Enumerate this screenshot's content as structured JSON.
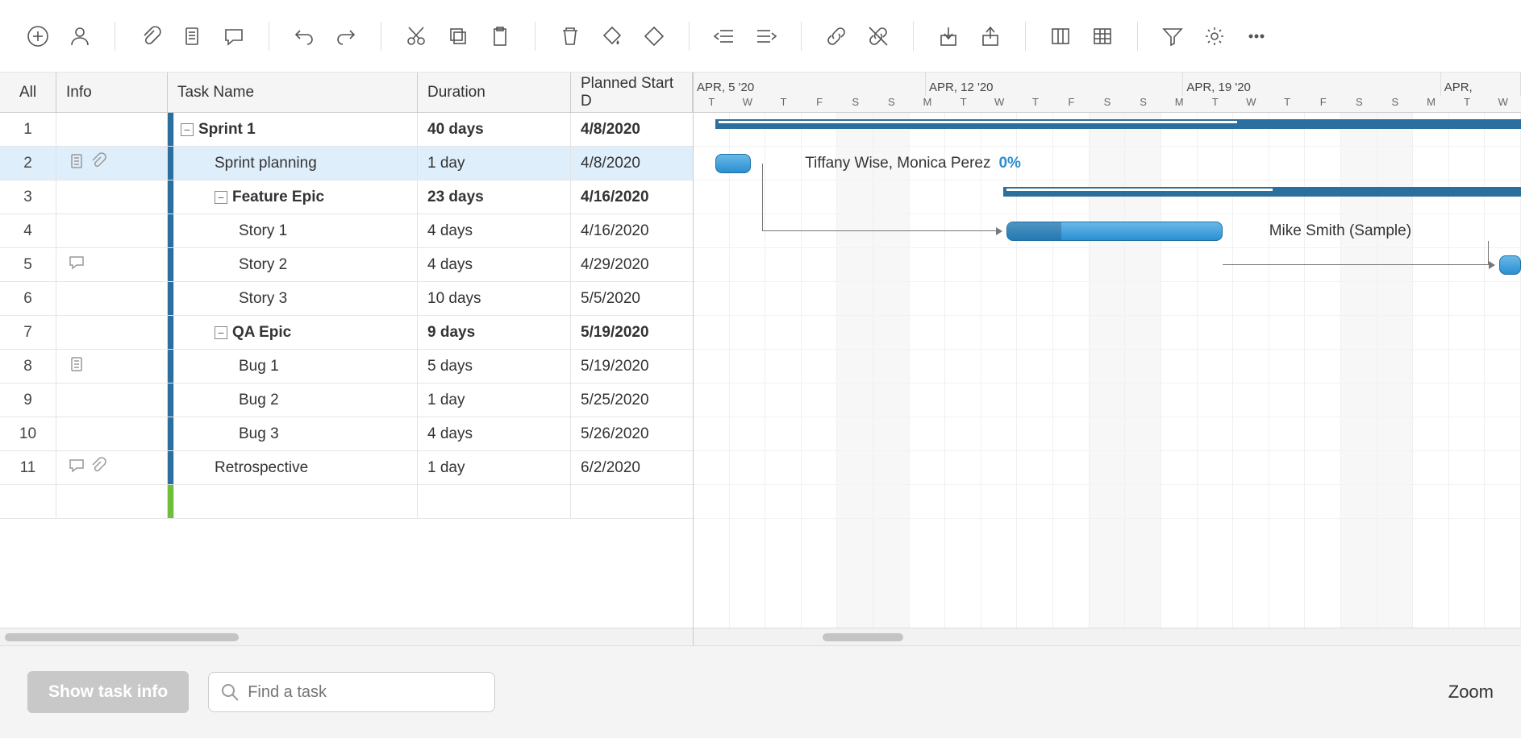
{
  "toolbar_icons": [
    "add",
    "person",
    "sep",
    "attach",
    "doc",
    "comment",
    "sep",
    "undo",
    "redo",
    "sep",
    "cut",
    "copy",
    "paste",
    "sep",
    "delete",
    "fill",
    "diamond",
    "sep",
    "outdent",
    "indent",
    "sep",
    "link",
    "unlink",
    "sep",
    "import",
    "export",
    "sep",
    "columns",
    "grid",
    "sep",
    "filter",
    "settings",
    "more"
  ],
  "grid": {
    "headers": {
      "all": "All",
      "info": "Info",
      "task": "Task Name",
      "duration": "Duration",
      "start": "Planned Start D"
    },
    "rows": [
      {
        "num": "1",
        "icons": [],
        "indent": 0,
        "collapsible": true,
        "name": "Sprint 1",
        "duration": "40 days",
        "start": "4/8/2020",
        "bold": true,
        "selected": false
      },
      {
        "num": "2",
        "icons": [
          "doc",
          "clip"
        ],
        "indent": 1,
        "collapsible": false,
        "name": "Sprint planning",
        "duration": "1 day",
        "start": "4/8/2020",
        "bold": false,
        "selected": true
      },
      {
        "num": "3",
        "icons": [],
        "indent": 1,
        "collapsible": true,
        "name": "Feature Epic",
        "duration": "23 days",
        "start": "4/16/2020",
        "bold": true,
        "selected": false
      },
      {
        "num": "4",
        "icons": [],
        "indent": 2,
        "collapsible": false,
        "name": "Story 1",
        "duration": "4 days",
        "start": "4/16/2020",
        "bold": false,
        "selected": false
      },
      {
        "num": "5",
        "icons": [
          "comment"
        ],
        "indent": 2,
        "collapsible": false,
        "name": "Story 2",
        "duration": "4 days",
        "start": "4/29/2020",
        "bold": false,
        "selected": false
      },
      {
        "num": "6",
        "icons": [],
        "indent": 2,
        "collapsible": false,
        "name": "Story 3",
        "duration": "10 days",
        "start": "5/5/2020",
        "bold": false,
        "selected": false
      },
      {
        "num": "7",
        "icons": [],
        "indent": 1,
        "collapsible": true,
        "name": "QA Epic",
        "duration": "9 days",
        "start": "5/19/2020",
        "bold": true,
        "selected": false
      },
      {
        "num": "8",
        "icons": [
          "doc"
        ],
        "indent": 2,
        "collapsible": false,
        "name": "Bug 1",
        "duration": "5 days",
        "start": "5/19/2020",
        "bold": false,
        "selected": false
      },
      {
        "num": "9",
        "icons": [],
        "indent": 2,
        "collapsible": false,
        "name": "Bug 2",
        "duration": "1 day",
        "start": "5/25/2020",
        "bold": false,
        "selected": false
      },
      {
        "num": "10",
        "icons": [],
        "indent": 2,
        "collapsible": false,
        "name": "Bug 3",
        "duration": "4 days",
        "start": "5/26/2020",
        "bold": false,
        "selected": false
      },
      {
        "num": "11",
        "icons": [
          "comment",
          "clip"
        ],
        "indent": 1,
        "collapsible": false,
        "name": "Retrospective",
        "duration": "1 day",
        "start": "6/2/2020",
        "bold": false,
        "selected": false
      }
    ]
  },
  "gantt": {
    "weeks": [
      "APR, 5 '20",
      "APR, 12 '20",
      "APR, 19 '20",
      "APR,"
    ],
    "days": [
      "T",
      "W",
      "T",
      "F",
      "S",
      "S",
      "M",
      "T",
      "W",
      "T",
      "F",
      "S",
      "S",
      "M",
      "T",
      "W",
      "T",
      "F",
      "S",
      "S",
      "M",
      "T",
      "W"
    ],
    "row2_label": "Tiffany Wise, Monica Perez",
    "row2_pct": "0%",
    "row4_label": "Mike Smith (Sample)"
  },
  "footer": {
    "show_task_info": "Show task info",
    "search_placeholder": "Find a task",
    "zoom_label": "Zoom"
  }
}
